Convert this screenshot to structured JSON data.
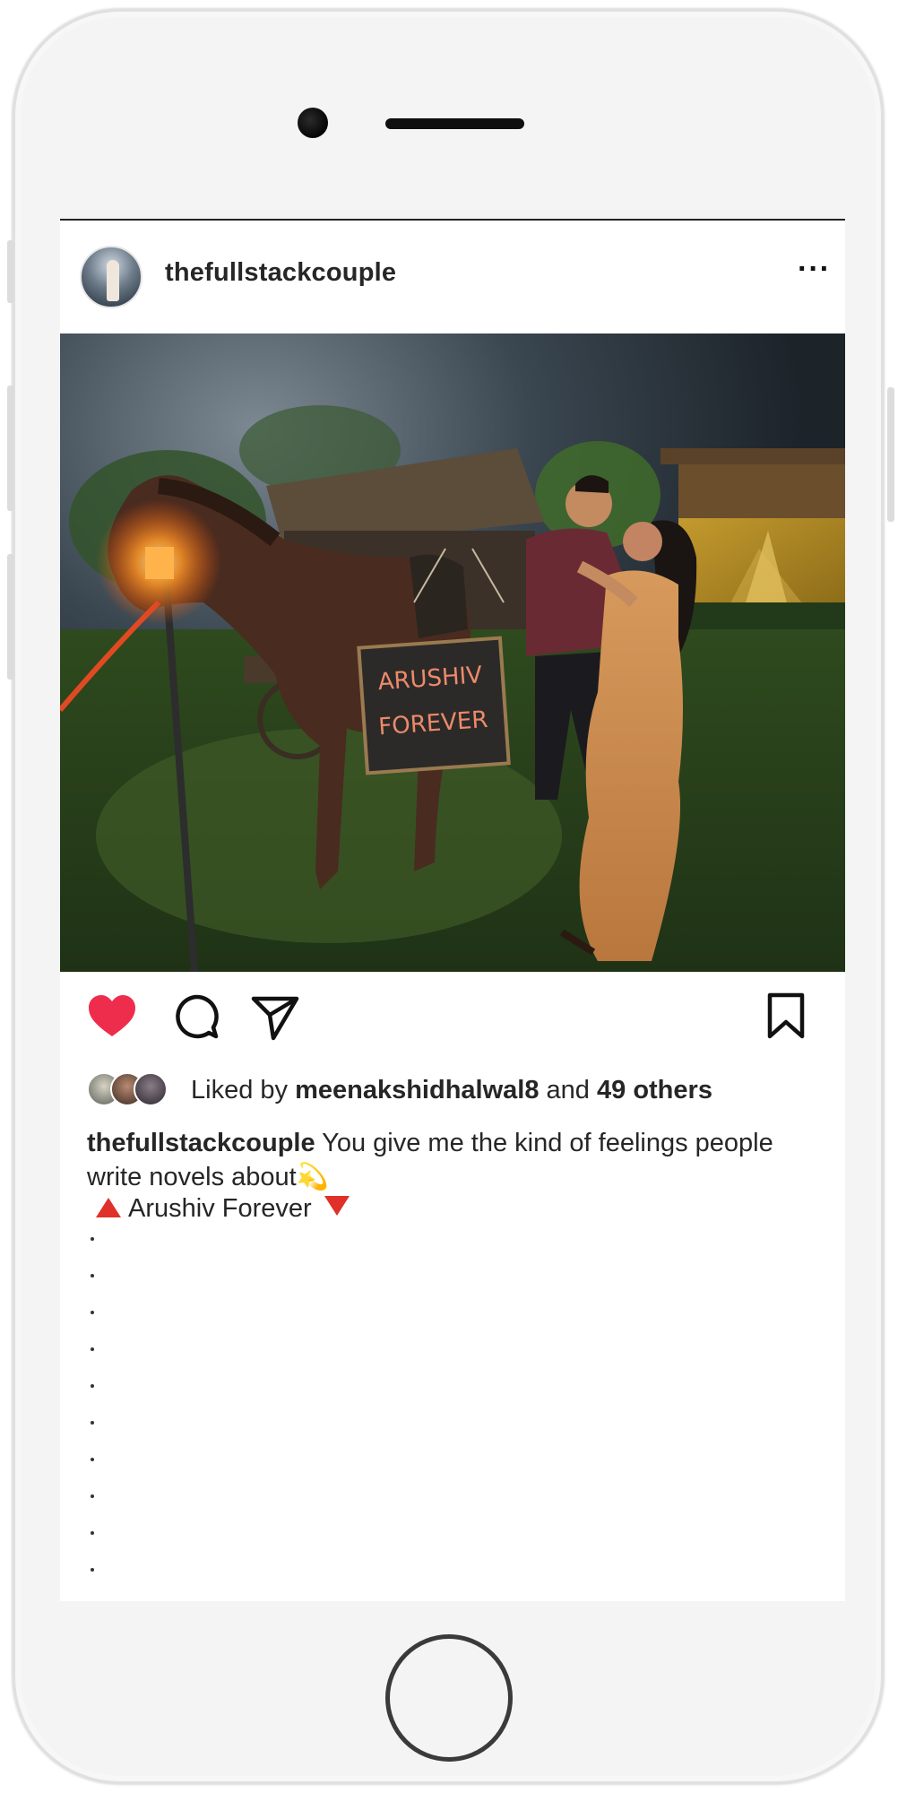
{
  "post": {
    "username": "thefullstackcouple",
    "more_icon": "more-horizontal-icon",
    "photo": {
      "sign_line1": "ARUSHIV",
      "sign_line2": "FOREVER"
    },
    "actions": {
      "like_icon": "heart-filled-icon",
      "comment_icon": "comment-icon",
      "share_icon": "paper-plane-icon",
      "save_icon": "bookmark-icon",
      "like_color": "#ee2d4d"
    },
    "likes": {
      "prefix": "Liked by",
      "user": "meenakshidhalwal8",
      "connector": "and",
      "others": "49 others"
    },
    "caption": {
      "username": "thefullstackcouple",
      "text": "You give me the kind of feelings people write novels about",
      "emoji": "💫",
      "tag_text": "Arushiv Forever",
      "tag_color": "#e0302a"
    }
  }
}
